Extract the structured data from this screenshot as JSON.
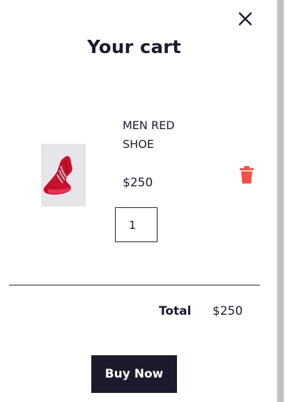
{
  "cart": {
    "title": "Your cart",
    "close_icon": "close-icon",
    "items": [
      {
        "name": "MEN RED SHOE",
        "price": "$250",
        "quantity": "1",
        "image_icon": "red-sneaker-image",
        "delete_icon": "trash-icon"
      }
    ],
    "total_label": "Total",
    "total_value": "$250",
    "buy_label": "Buy Now"
  },
  "colors": {
    "text": "#1c1b2e",
    "button_bg": "#1c1b2e",
    "button_text": "#ffffff",
    "delete_icon": "#f0504a",
    "image_bg": "#e5e5ea",
    "shoe": "#c8102e"
  }
}
